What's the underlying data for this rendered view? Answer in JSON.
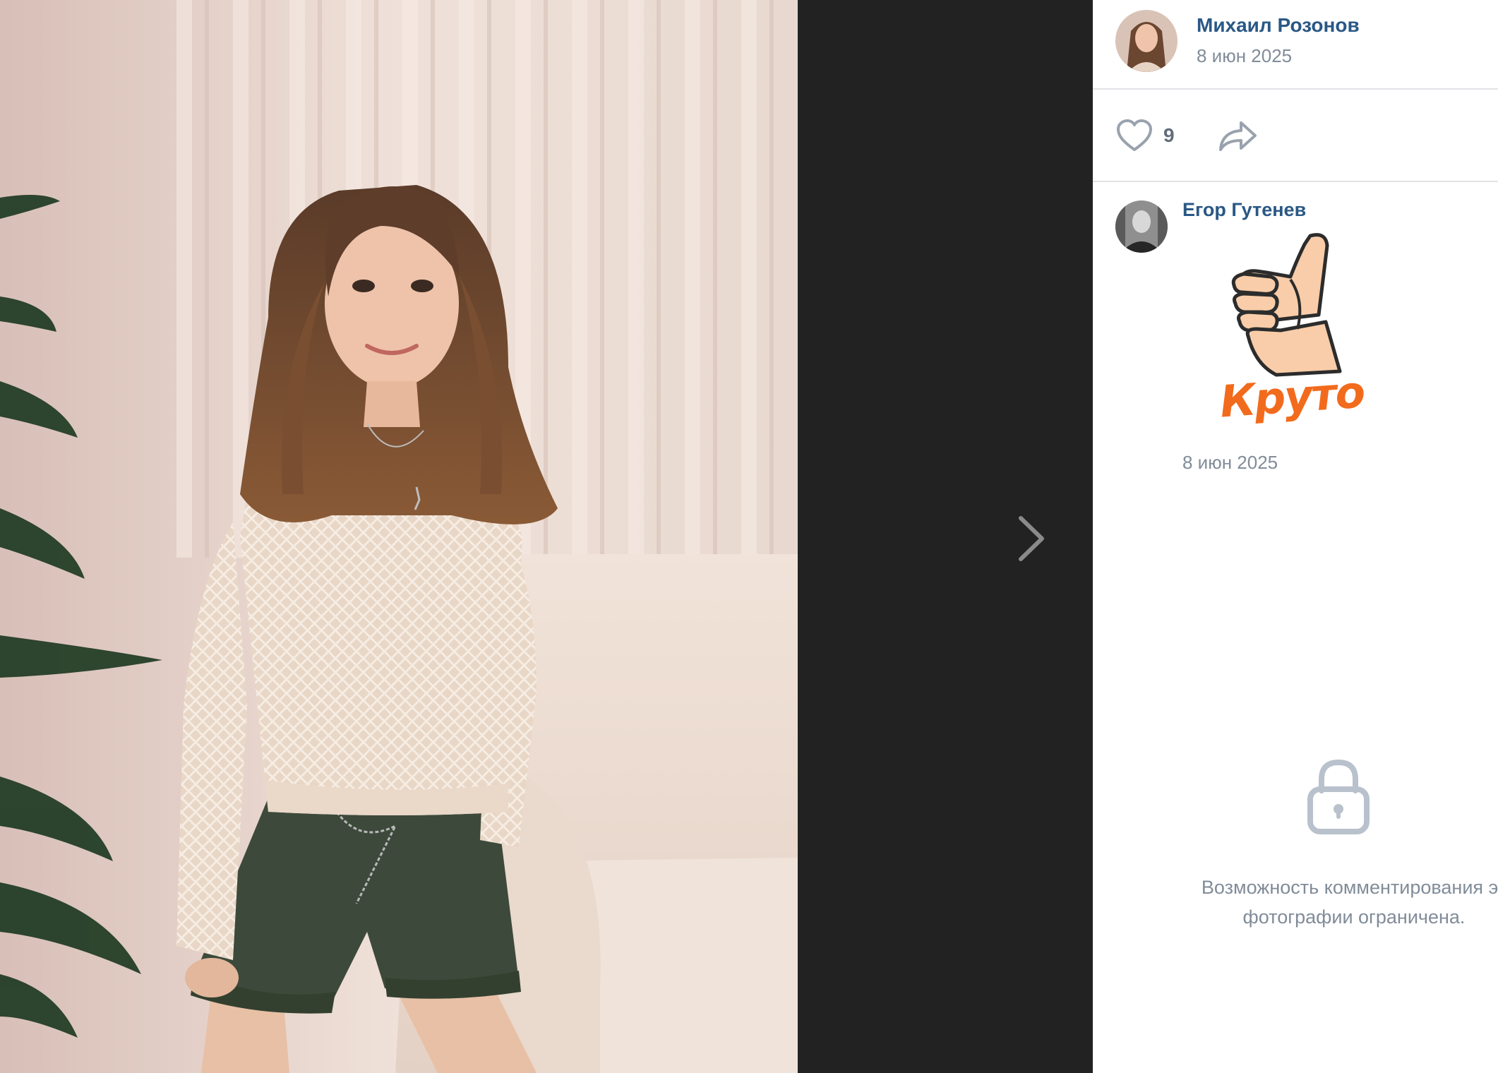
{
  "post": {
    "author_name": "Михаил Розонов",
    "date": "8 июн 2025",
    "likes": "9"
  },
  "comment": {
    "author_name": "Егор Гутенев",
    "sticker_text": "Круто",
    "date": "8 июн 2025"
  },
  "restriction": {
    "message": "Возможность комментирования эт\nфотографии ограничена."
  },
  "icons": {
    "like": "heart-icon",
    "share": "share-icon",
    "next": "chevron-right-icon",
    "lock": "lock-icon"
  },
  "colors": {
    "link": "#2a5885",
    "muted": "#818c99",
    "viewer_bg": "#222222",
    "sticker": "#f26b1d"
  }
}
